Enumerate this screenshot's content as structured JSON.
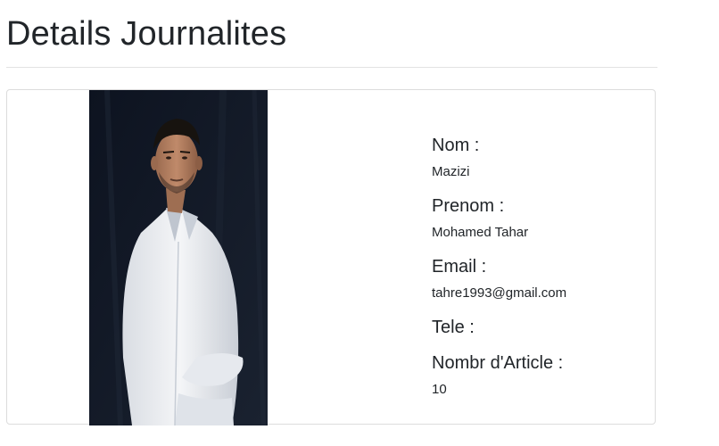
{
  "page": {
    "title": "Details Journalites"
  },
  "profile": {
    "photo_alt": "Photo",
    "fields": {
      "nom": {
        "label": "Nom :",
        "value": "Mazizi"
      },
      "prenom": {
        "label": "Prenom :",
        "value": "Mohamed Tahar"
      },
      "email": {
        "label": "Email :",
        "value": "tahre1993@gmail.com"
      },
      "tele": {
        "label": "Tele :",
        "value": ""
      },
      "articles": {
        "label": "Nombr d'Article :",
        "value": "10"
      }
    }
  },
  "colors": {
    "text": "#212529",
    "divider": "#e3e3e3",
    "card_border": "#dcdcdc",
    "photo_bg": "#111723"
  }
}
